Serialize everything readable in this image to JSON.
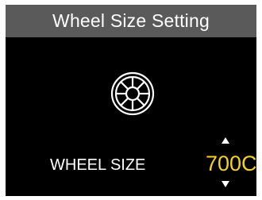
{
  "screen": {
    "title": "Wheel Size Setting"
  },
  "wheel": {
    "icon": "wheel-icon",
    "label": "WHEEL SIZE",
    "value": "700C",
    "value_color": "#f5d31d",
    "up_icon": "chevron-up-icon",
    "down_icon": "chevron-down-icon"
  }
}
